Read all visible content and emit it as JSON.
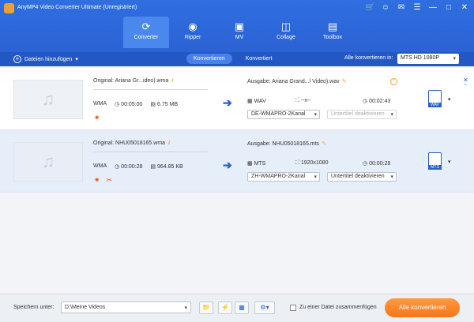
{
  "app": {
    "title": "AnyMP4 Video Converter Ultimate (Unregistriert)"
  },
  "nav": {
    "tabs": [
      {
        "label": "Converter",
        "icon": "convert-icon"
      },
      {
        "label": "Ripper",
        "icon": "disc-icon"
      },
      {
        "label": "MV",
        "icon": "tv-icon"
      },
      {
        "label": "Collage",
        "icon": "collage-icon"
      },
      {
        "label": "Toolbox",
        "icon": "toolbox-icon"
      }
    ]
  },
  "toolbar": {
    "add_files_label": "Dateien hinzufügen",
    "segment_converting": "Konvertieren",
    "segment_converted": "Konvertiert",
    "convert_all_to_label": "Alle konvertieren in:",
    "convert_all_format": "MTS HD 1080P"
  },
  "files": [
    {
      "original": "Original: Ariana Gr...ideo).wma",
      "format": "WMA",
      "duration": "00:05:00",
      "size": "6.75 MB",
      "output": "Ausgabe: Ariana Grand...l Video).wav",
      "out_format": "WAV",
      "out_resolution": "--x--",
      "out_duration": "00:02:43",
      "audio_track": "DE-WMAPRO-2Kanal",
      "subtitle": "Untertitel deaktivieren",
      "badge_ext": "WAV"
    },
    {
      "original": "Original: NHU05018165.wma",
      "format": "WMA",
      "duration": "00:00:28",
      "size": "964.85 KB",
      "output": "Ausgabe: NHU05018165.mts",
      "out_format": "MTS",
      "out_resolution": "1920x1080",
      "out_duration": "00:00:28",
      "audio_track": "ZH-WMAPRO-2Kanal",
      "subtitle": "Untertitel deaktivieren",
      "badge_ext": "MTS"
    }
  ],
  "footer": {
    "save_label": "Speichern unter:",
    "save_path": "D:\\Meine Videos",
    "merge_label": "Zu einer Datei zusammenfügen",
    "convert_all_button": "Alle konvertieren"
  },
  "colors": {
    "header": "#2f6fe0",
    "accent": "#f5761a"
  }
}
